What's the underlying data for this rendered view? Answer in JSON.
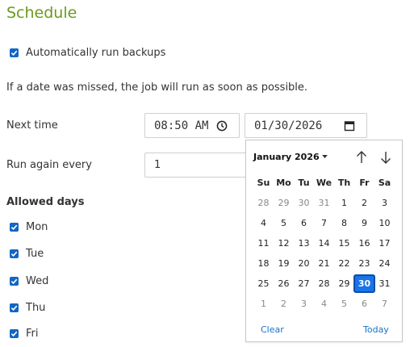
{
  "page": {
    "title": "Schedule"
  },
  "auto_backup": {
    "label": "Automatically run backups",
    "checked": true
  },
  "info_text": "If a date was missed, the job will run as soon as possible.",
  "next_time": {
    "label": "Next time",
    "time": "08:50 AM",
    "date": "01/30/2026"
  },
  "run_again": {
    "label": "Run again every",
    "value": "1"
  },
  "allowed_days": {
    "heading": "Allowed days",
    "days": [
      {
        "label": "Mon",
        "checked": true
      },
      {
        "label": "Tue",
        "checked": true
      },
      {
        "label": "Wed",
        "checked": true
      },
      {
        "label": "Thu",
        "checked": true
      },
      {
        "label": "Fri",
        "checked": true
      }
    ]
  },
  "calendar": {
    "month_label": "January 2026",
    "weekdays": [
      "Su",
      "Mo",
      "Tu",
      "We",
      "Th",
      "Fr",
      "Sa"
    ],
    "weeks": [
      [
        "28",
        "29",
        "30",
        "31",
        "1",
        "2",
        "3"
      ],
      [
        "4",
        "5",
        "6",
        "7",
        "8",
        "9",
        "10"
      ],
      [
        "11",
        "12",
        "13",
        "14",
        "15",
        "16",
        "17"
      ],
      [
        "18",
        "19",
        "20",
        "21",
        "22",
        "23",
        "24"
      ],
      [
        "25",
        "26",
        "27",
        "28",
        "29",
        "30",
        "31"
      ],
      [
        "1",
        "2",
        "3",
        "4",
        "5",
        "6",
        "7"
      ]
    ],
    "selected_day": "30",
    "clear_label": "Clear",
    "today_label": "Today"
  },
  "colors": {
    "accent": "#1266c4",
    "title": "#6b9a1a",
    "link": "#1a73c8"
  },
  "icons": {
    "time": "clock-icon",
    "date": "calendar-icon",
    "prev": "arrow-up-icon",
    "next": "arrow-down-icon"
  }
}
